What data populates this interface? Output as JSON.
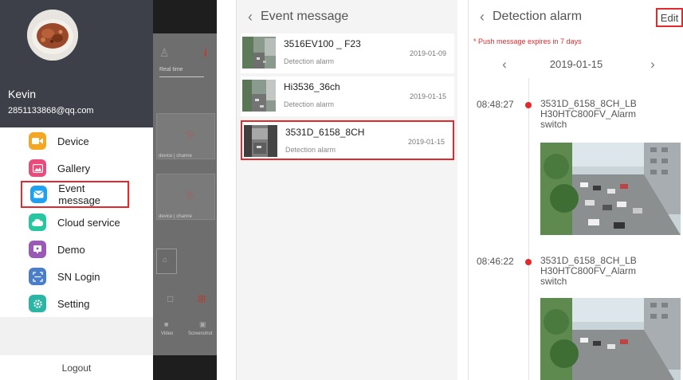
{
  "drawer": {
    "username": "Kevin",
    "email": "2851133868@qq.com",
    "menu": [
      {
        "label": "Device",
        "icon": "video-camera-icon",
        "color": "#f5a623"
      },
      {
        "label": "Gallery",
        "icon": "image-icon",
        "color": "#e94b7a"
      },
      {
        "label": "Event message",
        "icon": "mail-icon",
        "color": "#1ea1f2"
      },
      {
        "label": "Cloud service",
        "icon": "cloud-icon",
        "color": "#26c6a0"
      },
      {
        "label": "Demo",
        "icon": "demo-icon",
        "color": "#9b59b6"
      },
      {
        "label": "SN Login",
        "icon": "scan-icon",
        "color": "#4a7ec8"
      },
      {
        "label": "Setting",
        "icon": "gear-icon",
        "color": "#2bb5a5"
      }
    ],
    "logout": "Logout",
    "accent": "#e22a2e"
  },
  "behind": {
    "tab": "Real time",
    "card_label": "device | channe",
    "video_label": "Video",
    "screenshot_label": "Screenshot"
  },
  "event_message": {
    "title": "Event message",
    "items": [
      {
        "name": "3516EV100 _ F23",
        "type": "Detection alarm",
        "date": "2019-01-09"
      },
      {
        "name": "Hi3536_36ch",
        "type": "Detection alarm",
        "date": "2019-01-15"
      },
      {
        "name": "3531D_6158_8CH",
        "type": "Detection alarm",
        "date": "2019-01-15"
      }
    ]
  },
  "detection_alarm": {
    "title": "Detection alarm",
    "edit": "Edit",
    "expiry": "* Push message expires in 7 days",
    "date": "2019-01-15",
    "entries": [
      {
        "time": "08:48:27",
        "name": "3531D_6158_8CH_LB H30HTC800FV_Alarm switch"
      },
      {
        "time": "08:46:22",
        "name": "3531D_6158_8CH_LB H30HTC800FV_Alarm switch"
      }
    ]
  }
}
